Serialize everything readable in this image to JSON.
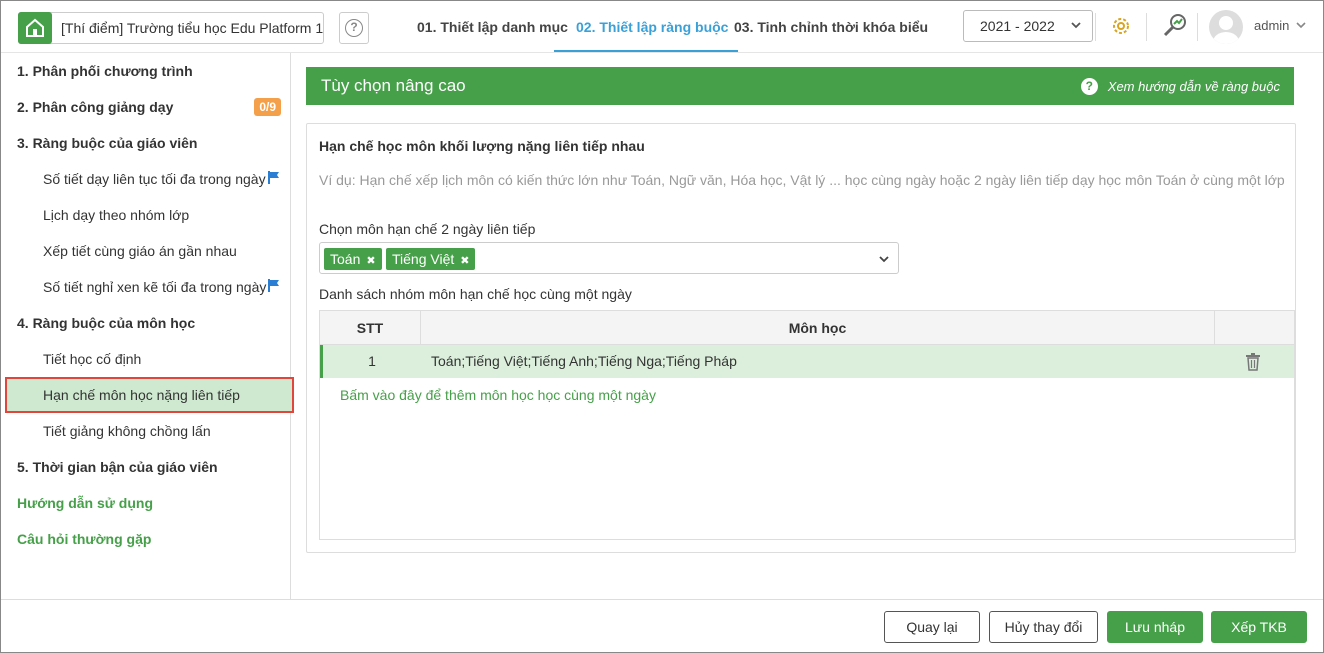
{
  "header": {
    "school_name": "[Thí điểm] Trường tiểu học Edu Platform 1",
    "steps": [
      {
        "label": "01. Thiết lập danh mục"
      },
      {
        "label": "02. Thiết lập ràng buộc"
      },
      {
        "label": "03. Tinh chỉnh thời khóa biểu"
      }
    ],
    "active_step": 1,
    "school_year": "2021 - 2022",
    "user": "admin",
    "icons": [
      "home-icon",
      "help-icon",
      "gear-icon",
      "chart-search-icon",
      "avatar",
      "chevron-down-icon"
    ]
  },
  "sidebar": {
    "items": [
      {
        "label": "1. Phân phối chương trình",
        "kind": "group"
      },
      {
        "label": "2. Phân công giảng dạy",
        "kind": "group",
        "badge": "0/9"
      },
      {
        "label": "3. Ràng buộc của giáo viên",
        "kind": "group"
      },
      {
        "label": "Số tiết dạy liên tục tối đa trong ngày",
        "kind": "sub",
        "flag": true
      },
      {
        "label": "Lịch dạy theo nhóm lớp",
        "kind": "sub"
      },
      {
        "label": "Xếp tiết cùng giáo án gần nhau",
        "kind": "sub"
      },
      {
        "label": "Số tiết nghỉ xen kẽ tối đa trong ngày",
        "kind": "sub",
        "flag": true
      },
      {
        "label": "4. Ràng buộc của môn học",
        "kind": "group"
      },
      {
        "label": "Tiết học cố định",
        "kind": "sub"
      },
      {
        "label": "Hạn chế môn học nặng liên tiếp",
        "kind": "sub",
        "selected": true
      },
      {
        "label": "Tiết giảng không chồng lấn",
        "kind": "sub"
      },
      {
        "label": "5. Thời gian bận của giáo viên",
        "kind": "group"
      },
      {
        "label": "Hướng dẫn sử dụng",
        "kind": "link"
      },
      {
        "label": "Câu hỏi thường gặp",
        "kind": "link"
      }
    ]
  },
  "main": {
    "panel_title": "Tùy chọn nâng cao",
    "guide_link": "Xem hướng dẫn về ràng buộc",
    "card_title": "Hạn chế học môn khối lượng nặng liên tiếp nhau",
    "example": "Ví dụ: Hạn chế xếp lịch môn có kiến thức lớn như Toán, Ngữ văn, Hóa học, Vật lý ... học cùng ngày hoặc 2 ngày liên tiếp dạy học môn Toán ở cùng một lớp",
    "select_label": "Chọn môn hạn chế 2 ngày liên tiếp",
    "selected_subjects": [
      "Toán",
      "Tiếng Việt"
    ],
    "list_label": "Danh sách nhóm môn hạn chế học cùng một ngày",
    "table": {
      "headers": [
        "STT",
        "Môn học"
      ],
      "rows": [
        {
          "stt": "1",
          "subjects": "Toán;Tiếng Việt;Tiếng Anh;Tiếng Nga;Tiếng Pháp"
        }
      ],
      "add_text": "Bấm vào đây để thêm môn học học cùng một ngày"
    }
  },
  "footer": {
    "back": "Quay lại",
    "cancel": "Hủy thay đổi",
    "save_draft": "Lưu nháp",
    "build": "Xếp TKB"
  },
  "colors": {
    "primary_green": "#46a049",
    "active_blue": "#3aa0d8",
    "badge_orange": "#f4a04a",
    "highlight_red": "#e0463c"
  }
}
